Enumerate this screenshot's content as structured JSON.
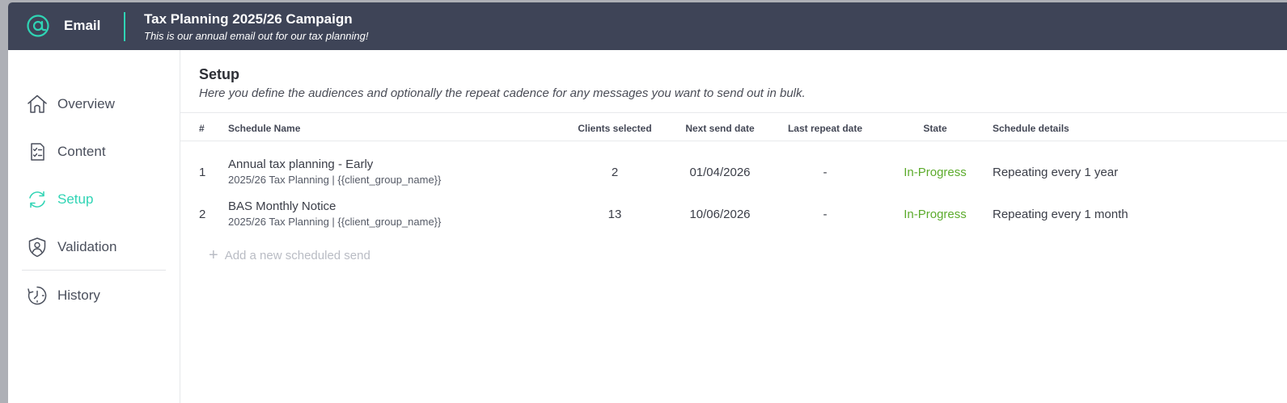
{
  "app": {
    "name": "Email",
    "icon": "at-sign-icon",
    "accent_color": "#2fd4b4",
    "header_bg": "#3e4457"
  },
  "campaign": {
    "title": "Tax Planning 2025/26 Campaign",
    "subtitle": "This is our annual email out for our tax planning!"
  },
  "sidebar": {
    "items": [
      {
        "label": "Overview",
        "icon": "home-icon",
        "active": false
      },
      {
        "label": "Content",
        "icon": "checklist-icon",
        "active": false
      },
      {
        "label": "Setup",
        "icon": "sync-icon",
        "active": true
      },
      {
        "label": "Validation",
        "icon": "shield-user-icon",
        "active": false
      },
      {
        "label": "History",
        "icon": "clock-history-icon",
        "active": false
      }
    ]
  },
  "setup": {
    "title": "Setup",
    "description": "Here you define the audiences and optionally the repeat cadence for any messages you want to send out in bulk."
  },
  "table": {
    "columns": [
      "#",
      "Schedule Name",
      "Clients selected",
      "Next send date",
      "Last repeat date",
      "State",
      "Schedule details"
    ],
    "rows": [
      {
        "num": "1",
        "name": "Annual tax planning - Early",
        "subject": "2025/26 Tax Planning | {{client_group_name}}",
        "clients": "2",
        "next_send": "01/04/2026",
        "last_repeat": "-",
        "state": "In-Progress",
        "details": "Repeating every 1 year"
      },
      {
        "num": "2",
        "name": "BAS Monthly Notice",
        "subject": "2025/26 Tax Planning | {{client_group_name}}",
        "clients": "13",
        "next_send": "10/06/2026",
        "last_repeat": "-",
        "state": "In-Progress",
        "details": "Repeating every 1 month"
      }
    ],
    "state_color": "#5cab2c"
  },
  "add_schedule": {
    "label": "Add a new scheduled send",
    "icon": "plus-icon"
  }
}
